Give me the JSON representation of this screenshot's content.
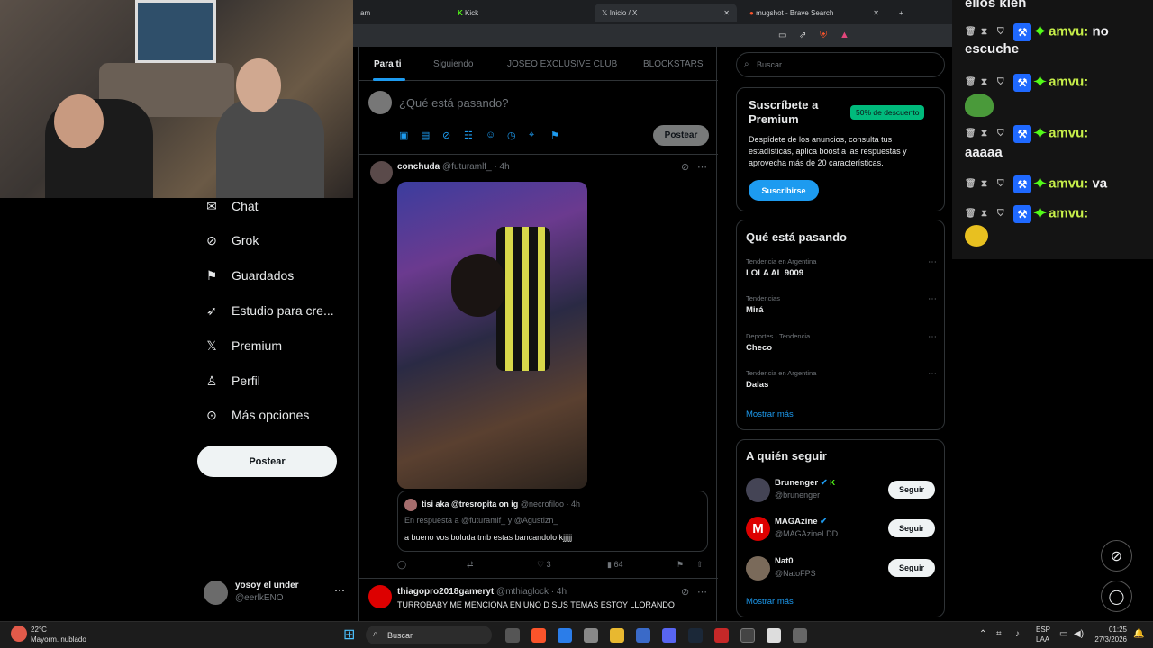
{
  "browser": {
    "tabs": [
      {
        "label": "am"
      },
      {
        "label": "Kick"
      },
      {
        "label": "Inicio / X"
      },
      {
        "label": "mugshot - Brave Search"
      }
    ]
  },
  "nav": {
    "items": [
      {
        "label": "Chat",
        "icon": "mail-icon"
      },
      {
        "label": "Grok",
        "icon": "grok-icon"
      },
      {
        "label": "Guardados",
        "icon": "bookmark-icon"
      },
      {
        "label": "Estudio para cre...",
        "icon": "rocket-icon"
      },
      {
        "label": "Premium",
        "icon": "x-logo-icon"
      },
      {
        "label": "Perfil",
        "icon": "person-icon"
      },
      {
        "label": "Más opciones",
        "icon": "more-circle-icon"
      }
    ],
    "post_label": "Postear",
    "profile": {
      "name": "yosoy el under",
      "handle": "@eerlkENO"
    }
  },
  "feed": {
    "tabs": [
      "Para ti",
      "Siguiendo",
      "JOSEO EXCLUSIVE CLUB",
      "BLOCKSTARS"
    ],
    "composer_placeholder": "¿Qué está pasando?",
    "composer_post": "Postear",
    "post1": {
      "name": "conchuda",
      "handle": "@futuramlf_",
      "time": "· 4h",
      "reply": {
        "name": "tisi aka @tresropita on ig",
        "handle": "@necrofiloo",
        "time": "· 4h",
        "in_reply": "En respuesta a @futuramlf_ y @Agustizn_",
        "text": "a bueno vos boluda tmb estas bancandolo kjjjjj"
      },
      "likes": "3",
      "views": "64"
    },
    "post2": {
      "name": "thiagopro2018gameryt",
      "handle": "@mthiaglock",
      "time": "· 4h",
      "text": "TURROBABY ME MENCIONA EN UNO D SUS TEMAS ESTOY LLORANDO"
    }
  },
  "right": {
    "search_placeholder": "Buscar",
    "premium": {
      "title": "Suscríbete a Premium",
      "badge": "50% de descuento",
      "desc": "Despídete de los anuncios, consulta tus estadísticas, aplica boost a las respuestas y aprovecha más de 20 características.",
      "button": "Suscribirse"
    },
    "trends_title": "Qué está pasando",
    "trends": [
      {
        "meta": "Tendencia en Argentina",
        "name": "LOLA AL 9009"
      },
      {
        "meta": "Tendencias",
        "name": "Mirá"
      },
      {
        "meta": "Deportes · Tendencia",
        "name": "Checo"
      },
      {
        "meta": "Tendencia en Argentina",
        "name": "Dalas"
      }
    ],
    "show_more": "Mostrar más",
    "follow_title": "A quién seguir",
    "follow": [
      {
        "name": "Brunenger",
        "handle": "@brunenger"
      },
      {
        "name": "MAGAzine",
        "handle": "@MAGAzineLDD"
      },
      {
        "name": "Nat0",
        "handle": "@NatoFPS"
      }
    ],
    "follow_label": "Seguir",
    "follow_more": "Mostrar más"
  },
  "chat": {
    "top_text": "ellos kien",
    "messages": [
      {
        "user": "amvu:",
        "text": "no escuche"
      },
      {
        "user": "amvu:",
        "text": ""
      },
      {
        "user": "amvu:",
        "text": "aaaaa"
      },
      {
        "user": "amvu:",
        "text": "va"
      },
      {
        "user": "amvu:",
        "text": ""
      }
    ]
  },
  "taskbar": {
    "weather_temp": "22°C",
    "weather_desc": "Mayorm. nublado",
    "search": "Buscar",
    "lang": "ESP",
    "lang2": "LAA",
    "time": "01:25",
    "date": "27/3/2026"
  }
}
